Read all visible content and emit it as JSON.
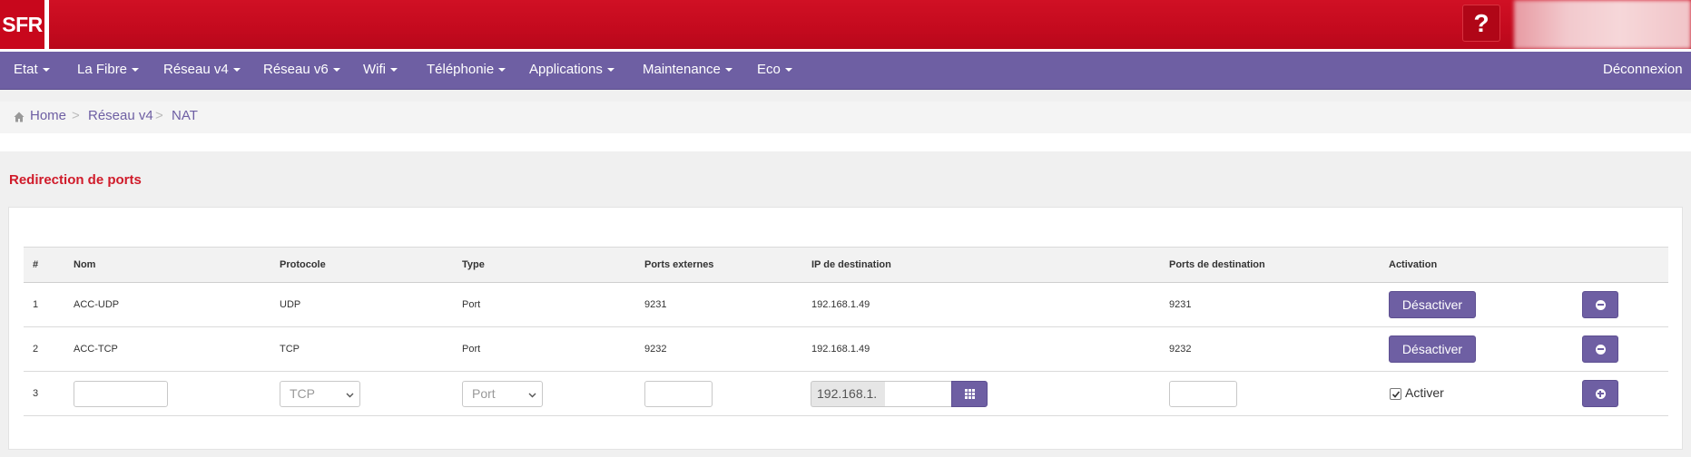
{
  "header": {
    "logo_text": "SFR",
    "help_label": "?"
  },
  "nav": {
    "items": [
      {
        "label": "Etat"
      },
      {
        "label": "La Fibre"
      },
      {
        "label": "Réseau v4"
      },
      {
        "label": "Réseau v6"
      },
      {
        "label": "Wifi"
      },
      {
        "label": "Téléphonie"
      },
      {
        "label": "Applications"
      },
      {
        "label": "Maintenance"
      },
      {
        "label": "Eco"
      }
    ],
    "logout_label": "Déconnexion"
  },
  "breadcrumb": {
    "home": "Home",
    "separator": ">",
    "level1": "Réseau v4",
    "current": "NAT"
  },
  "section_title": "Redirection de ports",
  "table": {
    "headers": {
      "num": "#",
      "nom": "Nom",
      "protocole": "Protocole",
      "type": "Type",
      "ports_ext": "Ports externes",
      "ip_dest": "IP de destination",
      "ports_dest": "Ports de destination",
      "activation": "Activation"
    },
    "rows": [
      {
        "num": "1",
        "nom": "ACC-UDP",
        "protocole": "UDP",
        "type": "Port",
        "ports_ext": "9231",
        "ip_dest": "192.168.1.49",
        "ports_dest": "9231",
        "action_label": "Désactiver"
      },
      {
        "num": "2",
        "nom": "ACC-TCP",
        "protocole": "TCP",
        "type": "Port",
        "ports_ext": "9232",
        "ip_dest": "192.168.1.49",
        "ports_dest": "9232",
        "action_label": "Désactiver"
      }
    ],
    "new_row": {
      "num": "3",
      "nom_value": "",
      "protocole_selected": "TCP",
      "type_selected": "Port",
      "ports_ext_value": "",
      "ip_prefix": "192.168.1.",
      "ip_suffix_value": "",
      "ports_dest_value": "",
      "activer_label": "Activer",
      "activer_checked": true
    }
  },
  "colors": {
    "brand_red": "#d01024",
    "nav_purple": "#6e5fa3",
    "title_red": "#d01b2a"
  },
  "icons": {
    "home": "home-icon",
    "help": "question-mark",
    "remove": "minus-circle-icon",
    "add": "plus-circle-icon",
    "ip_picker": "grid-icon",
    "select": "chevron-down-icon"
  }
}
